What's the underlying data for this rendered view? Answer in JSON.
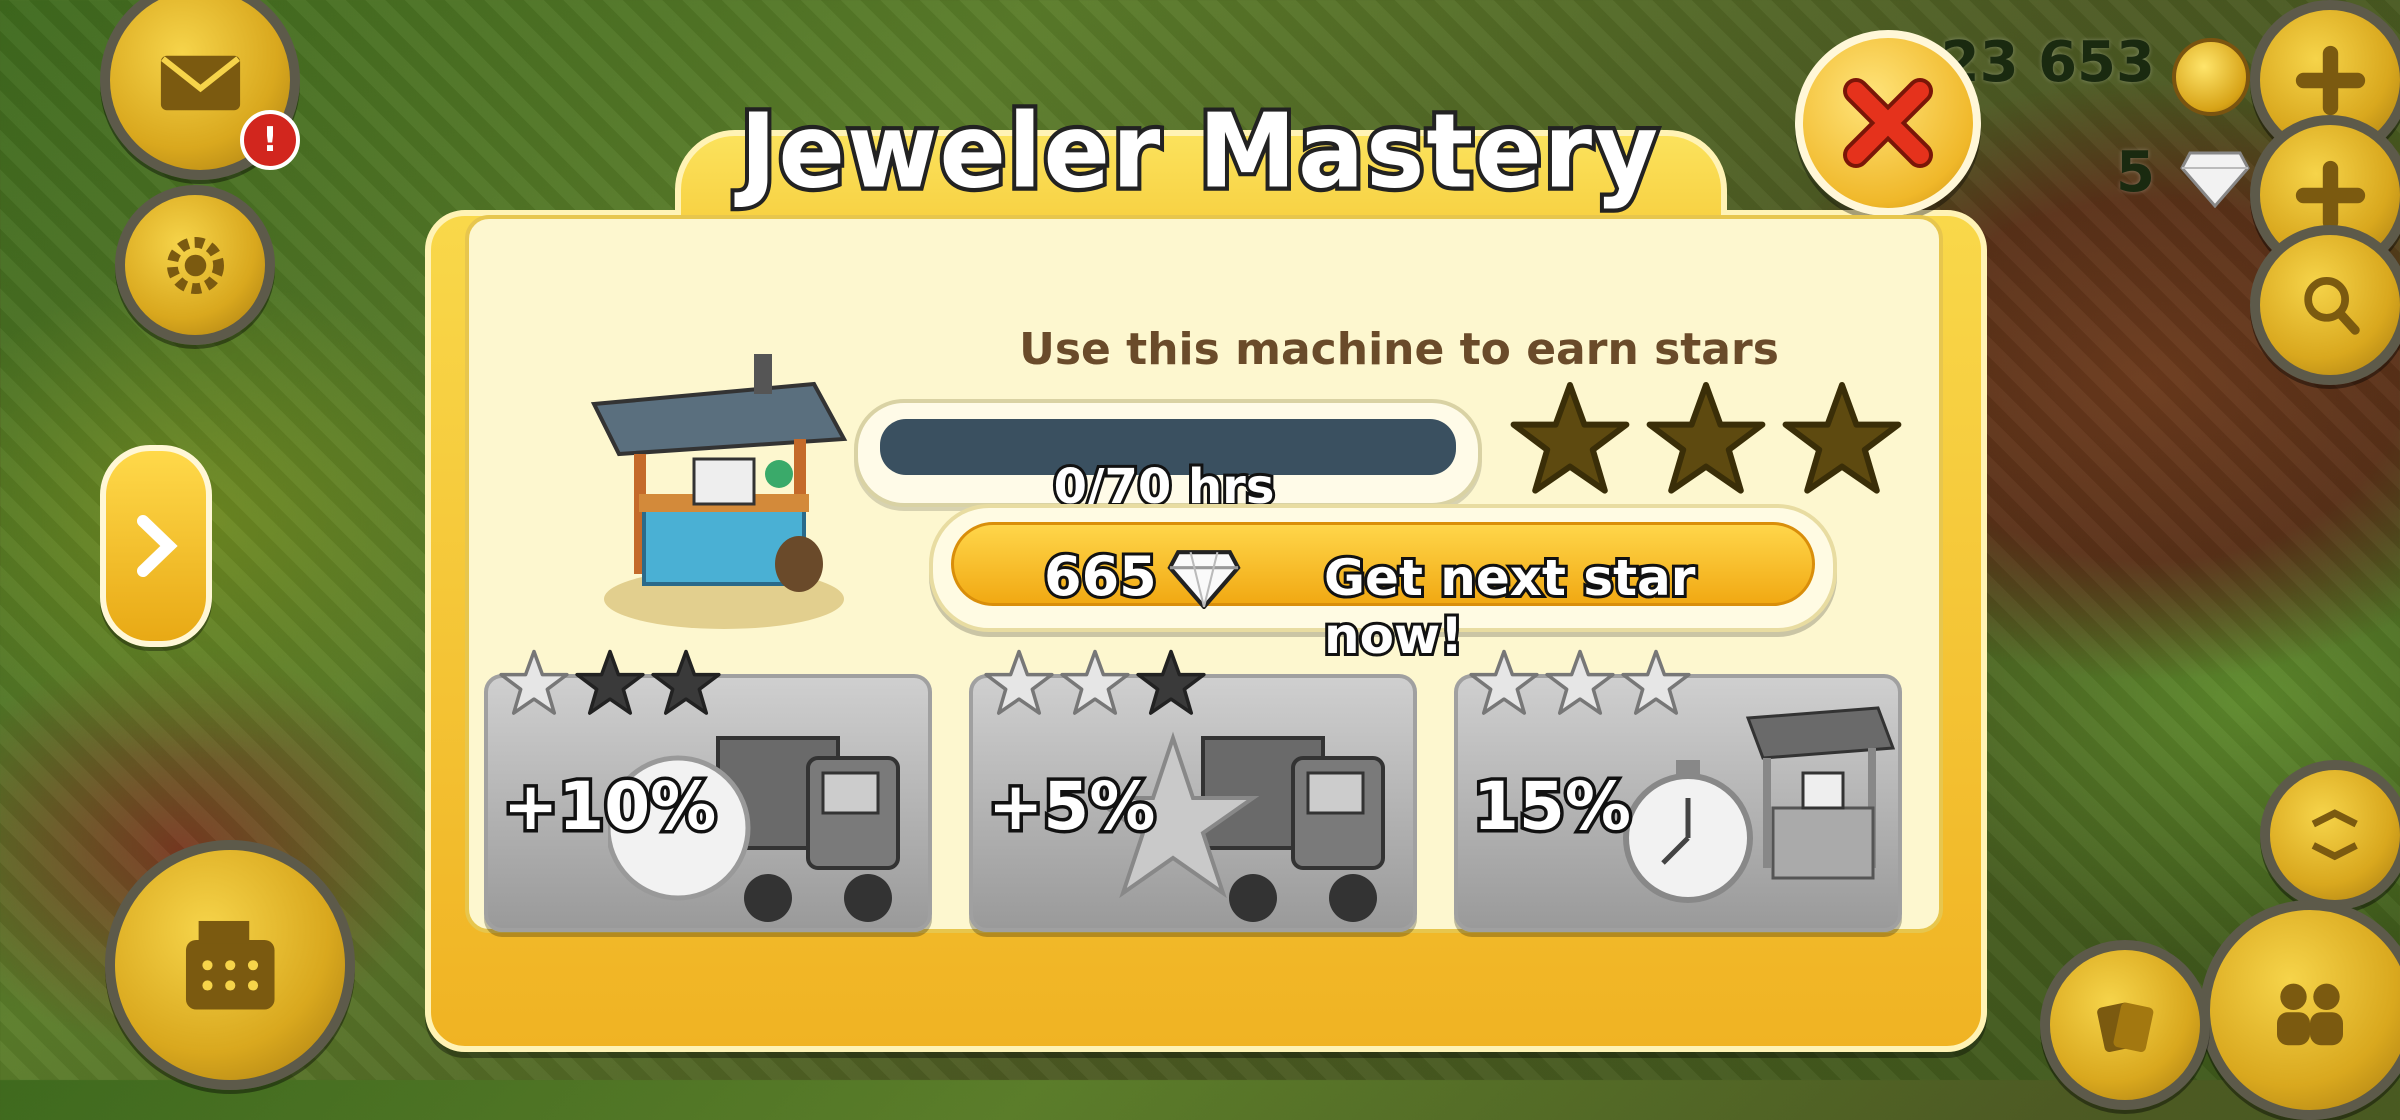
{
  "dialog": {
    "title": "Jeweler Mastery",
    "subtitle": "Use this machine to earn stars",
    "progress": {
      "text": "0/70 hrs",
      "current": 0,
      "total": 70,
      "fraction": 0.0
    },
    "stars_earned": 0,
    "stars_total": 3,
    "buy_button": {
      "cost": "665",
      "label": "Get next star now!"
    },
    "rewards": [
      {
        "stars_required": 1,
        "percent": "+10%",
        "icon": "coin-truck-icon"
      },
      {
        "stars_required": 2,
        "percent": "+5%",
        "icon": "star-truck-icon"
      },
      {
        "stars_required": 3,
        "percent": "15%",
        "icon": "stopwatch-machine-icon"
      }
    ]
  },
  "hud": {
    "coins": "923 653",
    "diamonds": "5",
    "mail_badge": "!"
  },
  "colors": {
    "panel_yellow": "#f4c22d",
    "panel_inner": "#fdf7cf",
    "button_orange": "#f1a913",
    "close_red": "#e5321c",
    "star_dark": "#5e4a10"
  }
}
